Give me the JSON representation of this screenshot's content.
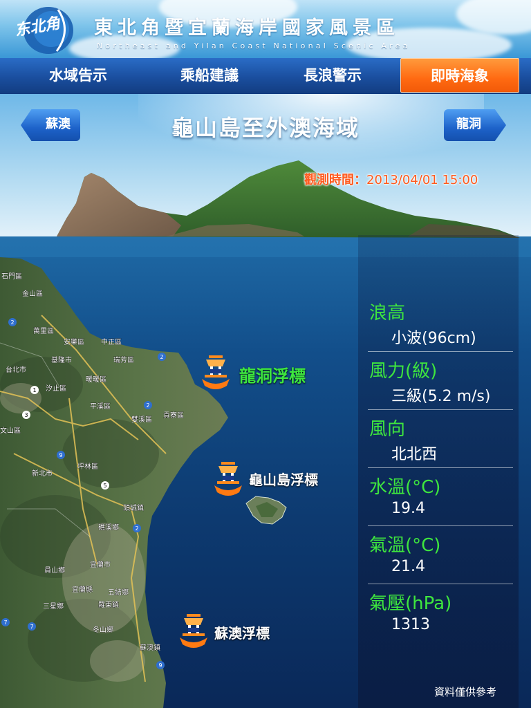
{
  "header": {
    "logo_text": "东北角",
    "title": "東北角暨宜蘭海岸國家風景區",
    "subtitle": "Northeast and Yilan Coast National Scenic Area"
  },
  "nav": {
    "items": [
      {
        "label": "水域告示",
        "active": false
      },
      {
        "label": "乘船建議",
        "active": false
      },
      {
        "label": "長浪警示",
        "active": false
      },
      {
        "label": "即時海象",
        "active": true
      }
    ]
  },
  "region": {
    "title": "龜山島至外澳海域",
    "prev_label": "蘇澳",
    "next_label": "龍洞"
  },
  "observation": {
    "label": "觀測時間：",
    "time": "2013/04/01 15:00"
  },
  "buoys": [
    {
      "label": "龍洞浮標",
      "highlighted": true
    },
    {
      "label": "龜山島浮標",
      "highlighted": false
    },
    {
      "label": "蘇澳浮標",
      "highlighted": false
    }
  ],
  "map_labels": [
    "石門區",
    "金山區",
    "萬里區",
    "安樂區",
    "中正區",
    "基隆市",
    "瑞芳區",
    "台北市",
    "汐止區",
    "暖暖區",
    "平溪區",
    "雙溪區",
    "貢寮區",
    "文山區",
    "新北市",
    "坪林區",
    "頭城鎮",
    "礁溪鄉",
    "員山鄉",
    "宜蘭市",
    "宜蘭縣",
    "五結鄉",
    "三星鄉",
    "羅東鎮",
    "冬山鄉",
    "蘇澳鎮"
  ],
  "metrics": [
    {
      "label": "浪高",
      "value": "小波(96cm)"
    },
    {
      "label": "風力(級)",
      "value": "三級(5.2 m/s)"
    },
    {
      "label": "風向",
      "value": "北北西"
    },
    {
      "label": "水溫(°C)",
      "value": "19.4"
    },
    {
      "label": "氣溫(°C)",
      "value": "21.4"
    },
    {
      "label": "氣壓(hPa)",
      "value": "1313"
    }
  ],
  "disclaimer": "資料僅供參考",
  "colors": {
    "metric_label": "#3ee63e",
    "active_tab": "#ff6a12",
    "obs_time": "#ff5a1e",
    "highlight_buoy_label": "#3ee63e"
  }
}
